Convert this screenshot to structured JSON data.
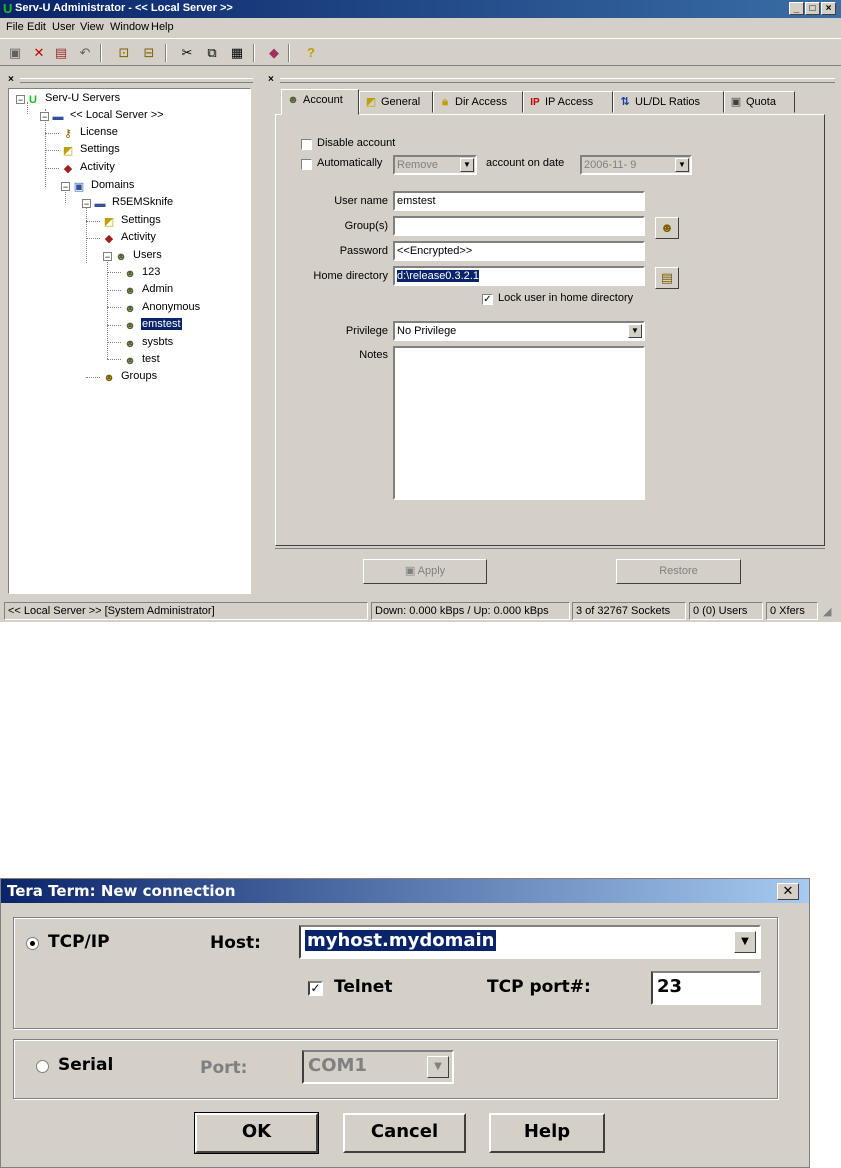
{
  "servu": {
    "title": "Serv-U Administrator - << Local Server >>",
    "menu": [
      "File",
      "Edit",
      "User",
      "View",
      "Window",
      "Help"
    ],
    "tree": {
      "root": "Serv-U Servers",
      "server": "<< Local Server >>",
      "license": "License",
      "settings": "Settings",
      "activity": "Activity",
      "domains": "Domains",
      "domain": "R5EMSknife",
      "domain_settings": "Settings",
      "domain_activity": "Activity",
      "users": "Users",
      "user_list": [
        "123",
        "Admin",
        "Anonymous",
        "emstest",
        "sysbts",
        "test"
      ],
      "selected_user": "emstest",
      "groups": "Groups"
    },
    "tabs": [
      "Account",
      "General",
      "Dir Access",
      "IP Access",
      "UL/DL Ratios",
      "Quota"
    ],
    "active_tab": "Account",
    "account": {
      "disable_account": "Disable account",
      "automatically": "Automatically",
      "auto_action": "Remove",
      "account_on_date": "account on date",
      "date": "2006-11-  9",
      "user_name_label": "User name",
      "user_name": "emstest",
      "groups_label": "Group(s)",
      "groups_value": "",
      "password_label": "Password",
      "password": "<<Encrypted>>",
      "home_dir_label": "Home directory",
      "home_dir": "d:\\release0.3.2.1",
      "lock_user": "Lock user in home directory",
      "lock_user_checked": true,
      "privilege_label": "Privilege",
      "privilege": "No Privilege",
      "notes_label": "Notes",
      "notes": ""
    },
    "buttons": {
      "apply": "Apply",
      "restore": "Restore"
    },
    "status": {
      "server": "<< Local Server >>  [System Administrator]",
      "traffic": "Down: 0.000 kBps / Up: 0.000 kBps",
      "sockets": "3 of 32767 Sockets",
      "users": "0 (0) Users",
      "xfers": "0 Xfers"
    }
  },
  "teraterm": {
    "title": "Tera Term: New connection",
    "tcpip_label": "TCP/IP",
    "host_label": "Host:",
    "host": "myhost.mydomain",
    "telnet_label": "Telnet",
    "telnet_checked": true,
    "tcp_port_label": "TCP port#:",
    "tcp_port": "23",
    "serial_label": "Serial",
    "port_label": "Port:",
    "port": "COM1",
    "ok": "OK",
    "cancel": "Cancel",
    "help": "Help",
    "selected_mode": "TCP/IP"
  }
}
